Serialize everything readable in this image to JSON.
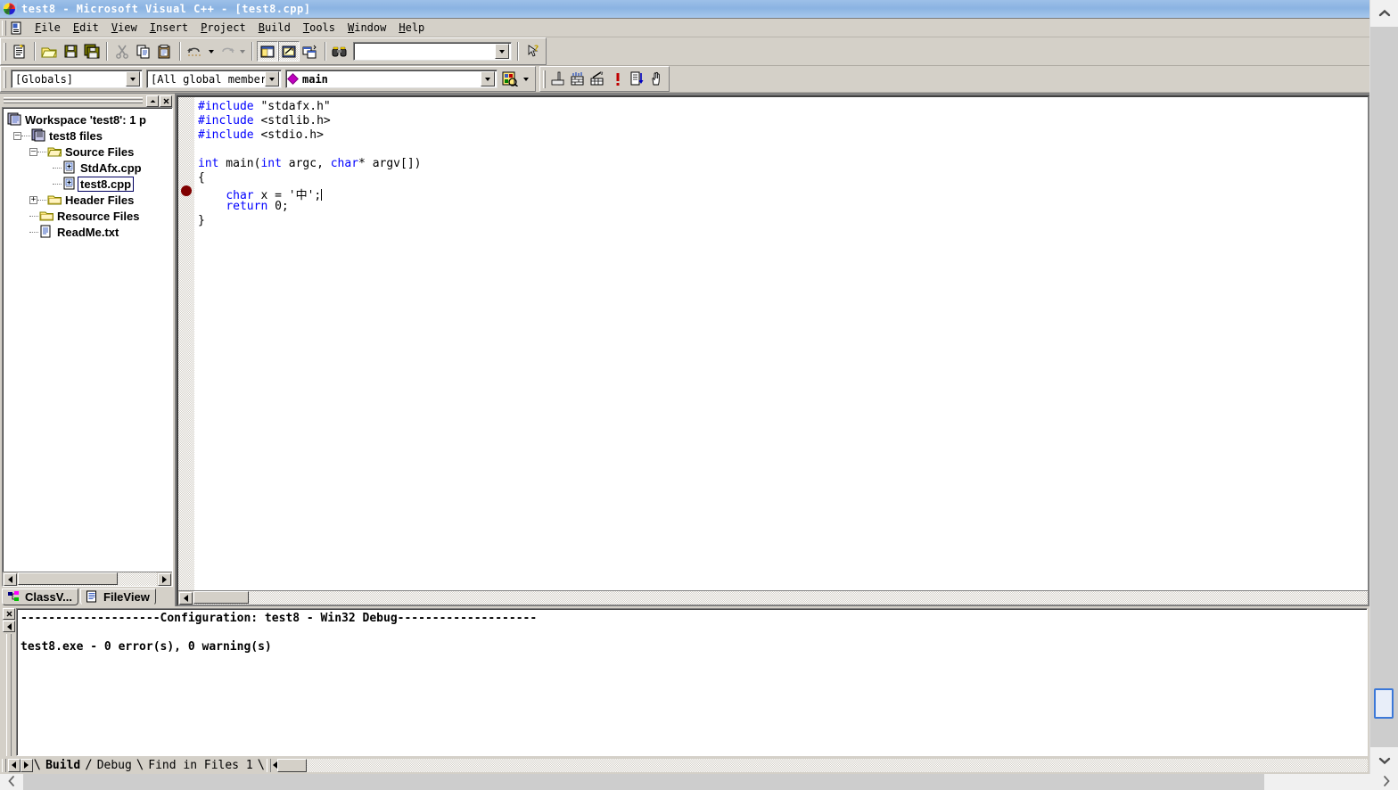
{
  "window": {
    "title": "test8 - Microsoft Visual C++ - [test8.cpp]",
    "app_icon": "vcpp-logo-icon"
  },
  "menubar": {
    "doc_icon": "document-properties-icon",
    "items": [
      {
        "label": "File"
      },
      {
        "label": "Edit"
      },
      {
        "label": "View"
      },
      {
        "label": "Insert"
      },
      {
        "label": "Project"
      },
      {
        "label": "Build"
      },
      {
        "label": "Tools"
      },
      {
        "label": "Window"
      },
      {
        "label": "Help"
      }
    ]
  },
  "standard_toolbar": {
    "buttons": [
      {
        "name": "new-text-file-button",
        "icon": "new-document-icon"
      },
      {
        "name": "open-button",
        "icon": "open-folder-icon"
      },
      {
        "name": "save-button",
        "icon": "floppy-disk-icon"
      },
      {
        "name": "save-all-button",
        "icon": "multiple-floppy-disks-icon"
      },
      {
        "name": "cut-button",
        "icon": "scissors-icon"
      },
      {
        "name": "copy-button",
        "icon": "copy-pages-icon"
      },
      {
        "name": "paste-button",
        "icon": "clipboard-icon"
      },
      {
        "name": "undo-button",
        "icon": "undo-arrow-icon"
      },
      {
        "name": "redo-button",
        "icon": "redo-arrow-icon"
      },
      {
        "name": "workspace-button",
        "icon": "workspace-window-icon"
      },
      {
        "name": "output-button",
        "icon": "output-window-icon"
      },
      {
        "name": "window-list-button",
        "icon": "cascade-windows-icon"
      },
      {
        "name": "find-in-files-button",
        "icon": "binoculars-icon"
      }
    ],
    "find_box": {
      "value": "",
      "placeholder": ""
    },
    "help_button": {
      "name": "context-help-button",
      "icon": "arrow-question-icon"
    }
  },
  "wizardbar": {
    "class_combo": {
      "value": "[Globals]"
    },
    "filter_combo": {
      "value": "[All global members"
    },
    "member_combo": {
      "value": "main",
      "icon": "member-diamond-icon"
    },
    "action_button": {
      "name": "wizardbar-action-button",
      "icon": "class-wizard-icon"
    }
  },
  "build_toolbar": {
    "buttons": [
      {
        "name": "compile-button",
        "icon": "compile-icon"
      },
      {
        "name": "build-button",
        "icon": "build-bricks-icon"
      },
      {
        "name": "stop-build-button",
        "icon": "stop-build-icon"
      },
      {
        "name": "execute-program-button",
        "icon": "red-exclamation-icon"
      },
      {
        "name": "go-button",
        "icon": "go-debug-icon"
      },
      {
        "name": "insert-remove-breakpoint-button",
        "icon": "hand-breakpoint-icon"
      }
    ]
  },
  "workspace_pane": {
    "caption": {
      "rollup_button": "rollup-icon",
      "close_button": "close-icon"
    },
    "tree": [
      {
        "depth": 0,
        "label": "Workspace 'test8': 1 p",
        "icon": "workspace-icon",
        "expander": "",
        "selected": false
      },
      {
        "depth": 1,
        "label": "test8 files",
        "icon": "project-icon",
        "expander": "-",
        "selected": false
      },
      {
        "depth": 2,
        "label": "Source Files",
        "icon": "open-folder-icon",
        "expander": "-",
        "selected": false
      },
      {
        "depth": 3,
        "label": "StdAfx.cpp",
        "icon": "cpp-file-icon",
        "expander": "",
        "selected": false
      },
      {
        "depth": 3,
        "label": "test8.cpp",
        "icon": "cpp-file-icon",
        "expander": "",
        "selected": true
      },
      {
        "depth": 2,
        "label": "Header Files",
        "icon": "closed-folder-icon",
        "expander": "+",
        "selected": false
      },
      {
        "depth": 2,
        "label": "Resource Files",
        "icon": "closed-folder-icon",
        "expander": "",
        "selected": false
      },
      {
        "depth": 2,
        "label": "ReadMe.txt",
        "icon": "text-file-icon",
        "expander": "",
        "selected": false
      }
    ],
    "tabs": [
      {
        "label": "ClassV...",
        "icon": "class-view-icon",
        "active": false
      },
      {
        "label": "FileView",
        "icon": "file-view-icon",
        "active": true
      }
    ]
  },
  "editor": {
    "filename": "test8.cpp",
    "breakpoint_line": 7,
    "lines": [
      {
        "n": 1,
        "tokens": [
          {
            "t": "#include",
            "c": "pp"
          },
          {
            "t": " \"stdafx.h\"",
            "c": "plain"
          }
        ]
      },
      {
        "n": 2,
        "tokens": [
          {
            "t": "#include",
            "c": "pp"
          },
          {
            "t": " <stdlib.h>",
            "c": "plain"
          }
        ]
      },
      {
        "n": 3,
        "tokens": [
          {
            "t": "#include",
            "c": "pp"
          },
          {
            "t": " <stdio.h>",
            "c": "plain"
          }
        ]
      },
      {
        "n": 4,
        "tokens": []
      },
      {
        "n": 5,
        "tokens": [
          {
            "t": "int",
            "c": "kw"
          },
          {
            "t": " main(",
            "c": "plain"
          },
          {
            "t": "int",
            "c": "kw"
          },
          {
            "t": " argc, ",
            "c": "plain"
          },
          {
            "t": "char",
            "c": "kw"
          },
          {
            "t": "* argv[])",
            "c": "plain"
          }
        ]
      },
      {
        "n": 6,
        "tokens": [
          {
            "t": "{",
            "c": "plain"
          }
        ]
      },
      {
        "n": 7,
        "tokens": [
          {
            "t": "    ",
            "c": "plain"
          },
          {
            "t": "char",
            "c": "kw"
          },
          {
            "t": " x = '中';",
            "c": "plain"
          }
        ]
      },
      {
        "n": 8,
        "tokens": [
          {
            "t": "    ",
            "c": "plain"
          },
          {
            "t": "return",
            "c": "kw"
          },
          {
            "t": " 0;",
            "c": "plain"
          }
        ]
      },
      {
        "n": 9,
        "tokens": [
          {
            "t": "}",
            "c": "plain"
          }
        ]
      }
    ]
  },
  "output_pane": {
    "close_button": "close-icon",
    "scroll_up_button": "scroll-up-icon",
    "lines": [
      "--------------------Configuration: test8 - Win32 Debug--------------------",
      "",
      "test8.exe - 0 error(s), 0 warning(s)"
    ],
    "tabs": [
      {
        "label": "Build",
        "active": true
      },
      {
        "label": "Debug",
        "active": false
      },
      {
        "label": "Find in Files 1",
        "active": false
      }
    ]
  },
  "scrollbars": {
    "outer_vertical": {
      "up_arrow": "chevron-up-icon",
      "down_arrow": "chevron-down-icon"
    },
    "outer_horizontal": {
      "left_arrow": "chevron-left-icon",
      "right_arrow": "chevron-right-icon"
    }
  },
  "colors": {
    "face": "#d4d0c8",
    "title_start": "#9dc0e8",
    "keyword_blue": "#0000ff",
    "breakpoint_red": "#800000",
    "selection_outline": "#000060",
    "scroll_thumb_accent": "#3b78d8"
  }
}
